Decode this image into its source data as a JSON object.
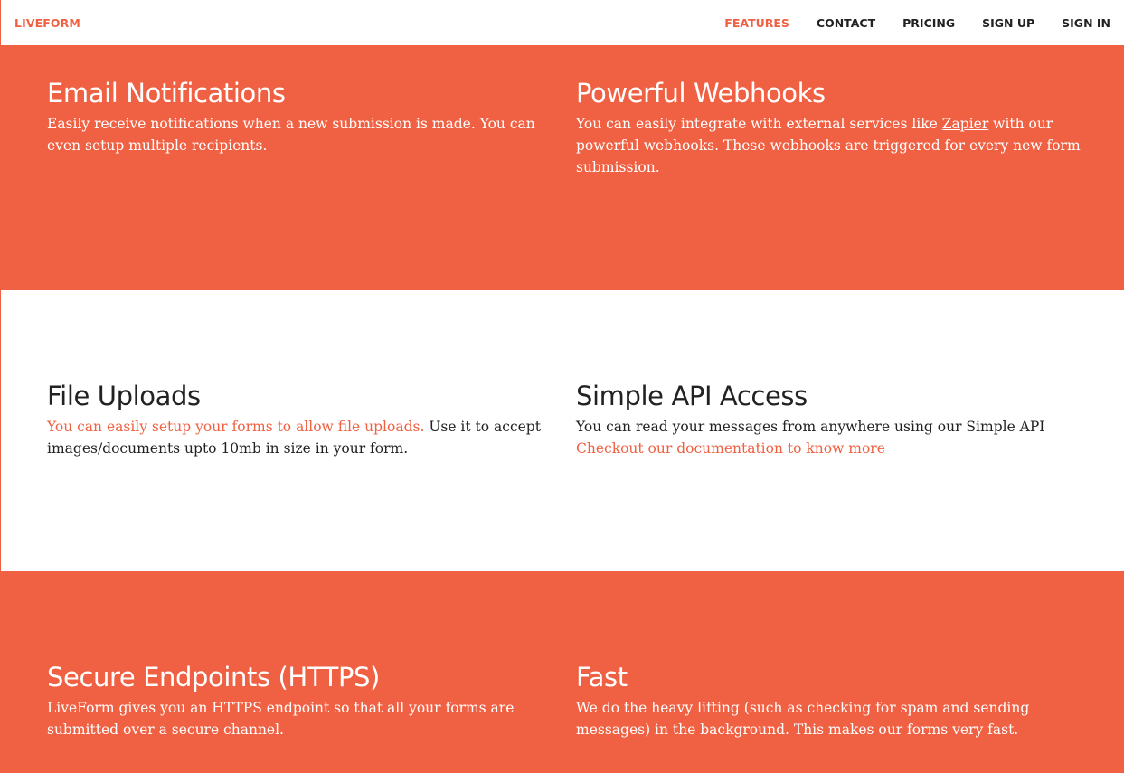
{
  "navbar": {
    "brand": "LIVEFORM",
    "links": [
      {
        "label": "FEATURES",
        "active": true
      },
      {
        "label": "CONTACT",
        "active": false
      },
      {
        "label": "PRICING",
        "active": false
      },
      {
        "label": "SIGN UP",
        "active": false
      },
      {
        "label": "SIGN IN",
        "active": false
      }
    ]
  },
  "colors": {
    "accent": "#f06042",
    "text": "#222222",
    "white": "#ffffff"
  },
  "features": {
    "email": {
      "title": "Email Notifications",
      "desc": "Easily receive notifications when a new submission is made. You can even setup multiple recipients."
    },
    "webhooks": {
      "title": "Powerful Webhooks",
      "desc_before": "You can easily integrate with external services like ",
      "link": "Zapier",
      "desc_after": " with our powerful webhooks. These webhooks are triggered for every new form submission."
    },
    "uploads": {
      "title": "File Uploads",
      "link": "You can easily setup your forms to allow file uploads.",
      "desc_after": " Use it to accept images/documents upto 10mb in size in your form."
    },
    "api": {
      "title": "Simple API Access",
      "desc": "You can read your messages from anywhere using our Simple API",
      "link": "Checkout our documentation to know more"
    },
    "https": {
      "title": "Secure Endpoints (HTTPS)",
      "desc": "LiveForm gives you an HTTPS endpoint so that all your forms are submitted over a secure channel."
    },
    "fast": {
      "title": "Fast",
      "desc": "We do the heavy lifting (such as checking for spam and sending messages) in the background. This makes our forms very fast."
    }
  }
}
